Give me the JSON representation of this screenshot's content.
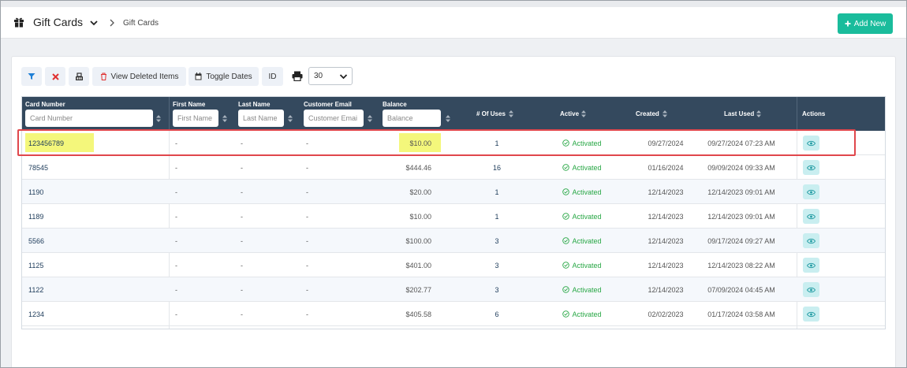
{
  "header": {
    "title": "Gift Cards",
    "breadcrumb": "Gift Cards",
    "add_new_label": "Add New"
  },
  "toolbar": {
    "view_deleted_label": "View Deleted Items",
    "toggle_dates_label": "Toggle Dates",
    "id_label": "ID",
    "per_page_value": "30"
  },
  "table": {
    "columns": {
      "card_number": "Card Number",
      "first_name": "First Name",
      "last_name": "Last Name",
      "customer_email": "Customer Email",
      "balance": "Balance",
      "uses": "# Of Uses",
      "active": "Active",
      "created": "Created",
      "last_used": "Last Used",
      "actions": "Actions"
    },
    "filters": {
      "card_number": "Card Number",
      "first_name": "First Name",
      "last_name": "Last Name",
      "customer_email": "Customer Emai",
      "balance": "Balance"
    },
    "rows": [
      {
        "card": "123456789",
        "first": "-",
        "last": "-",
        "email": "-",
        "balance": "$10.00",
        "uses": "1",
        "status": "Activated",
        "created": "09/27/2024",
        "last_used": "09/27/2024 07:23 AM"
      },
      {
        "card": "78545",
        "first": "-",
        "last": "-",
        "email": "-",
        "balance": "$444.46",
        "uses": "16",
        "status": "Activated",
        "created": "01/16/2024",
        "last_used": "09/09/2024 09:33 AM"
      },
      {
        "card": "1190",
        "first": "-",
        "last": "-",
        "email": "-",
        "balance": "$20.00",
        "uses": "1",
        "status": "Activated",
        "created": "12/14/2023",
        "last_used": "12/14/2023 09:01 AM"
      },
      {
        "card": "1189",
        "first": "-",
        "last": "-",
        "email": "-",
        "balance": "$10.00",
        "uses": "1",
        "status": "Activated",
        "created": "12/14/2023",
        "last_used": "12/14/2023 09:01 AM"
      },
      {
        "card": "5566",
        "first": "-",
        "last": "-",
        "email": "-",
        "balance": "$100.00",
        "uses": "3",
        "status": "Activated",
        "created": "12/14/2023",
        "last_used": "09/17/2024 09:27 AM"
      },
      {
        "card": "1125",
        "first": "-",
        "last": "-",
        "email": "-",
        "balance": "$401.00",
        "uses": "3",
        "status": "Activated",
        "created": "12/14/2023",
        "last_used": "12/14/2023 08:22 AM"
      },
      {
        "card": "1122",
        "first": "-",
        "last": "-",
        "email": "-",
        "balance": "$202.77",
        "uses": "3",
        "status": "Activated",
        "created": "12/14/2023",
        "last_used": "07/09/2024 04:45 AM"
      },
      {
        "card": "1234",
        "first": "-",
        "last": "-",
        "email": "-",
        "balance": "$405.58",
        "uses": "6",
        "status": "Activated",
        "created": "02/02/2023",
        "last_used": "01/17/2024 03:58 AM"
      }
    ]
  },
  "colors": {
    "accent": "#1abc9c",
    "header_bg": "#34495e",
    "status_green": "#28a745",
    "highlight_yellow": "#f4f77b",
    "annotation_red": "#e0474c"
  },
  "icons": [
    "gift-icon",
    "chevron-down-icon",
    "chevron-right-icon",
    "plus-icon",
    "filter-icon",
    "clear-filter-icon",
    "column-chooser-icon",
    "trash-icon",
    "calendar-icon",
    "print-icon",
    "sort-icon",
    "check-circle-icon",
    "eye-icon"
  ]
}
